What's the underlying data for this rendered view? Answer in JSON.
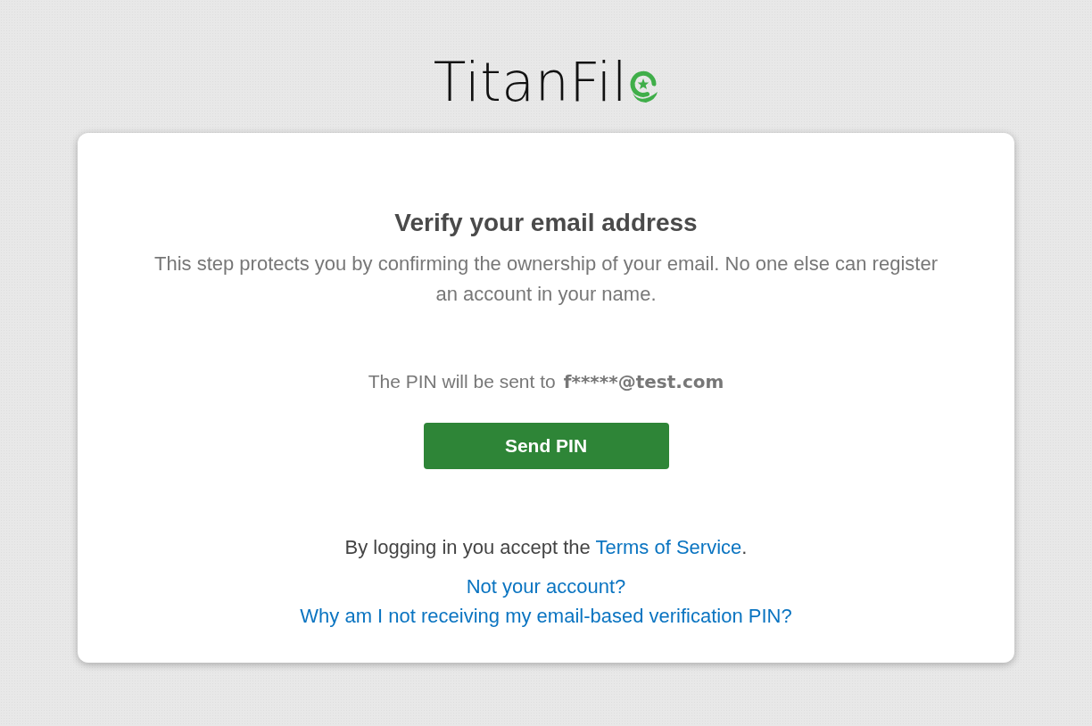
{
  "logo": {
    "text": "TitanFil"
  },
  "card": {
    "title": "Verify your email address",
    "description": "This step protects you by confirming the ownership of your email. No one else can register an account in your name.",
    "pin_notice": {
      "label": "The PIN will be sent to",
      "email": "f*****@test.com"
    },
    "send_button": "Send PIN",
    "terms": {
      "before": "By logging in you accept the",
      "link": "Terms of Service",
      "after": "."
    },
    "links": [
      "Not your account?",
      "Why am I not receiving my email-based verification PIN?"
    ]
  }
}
